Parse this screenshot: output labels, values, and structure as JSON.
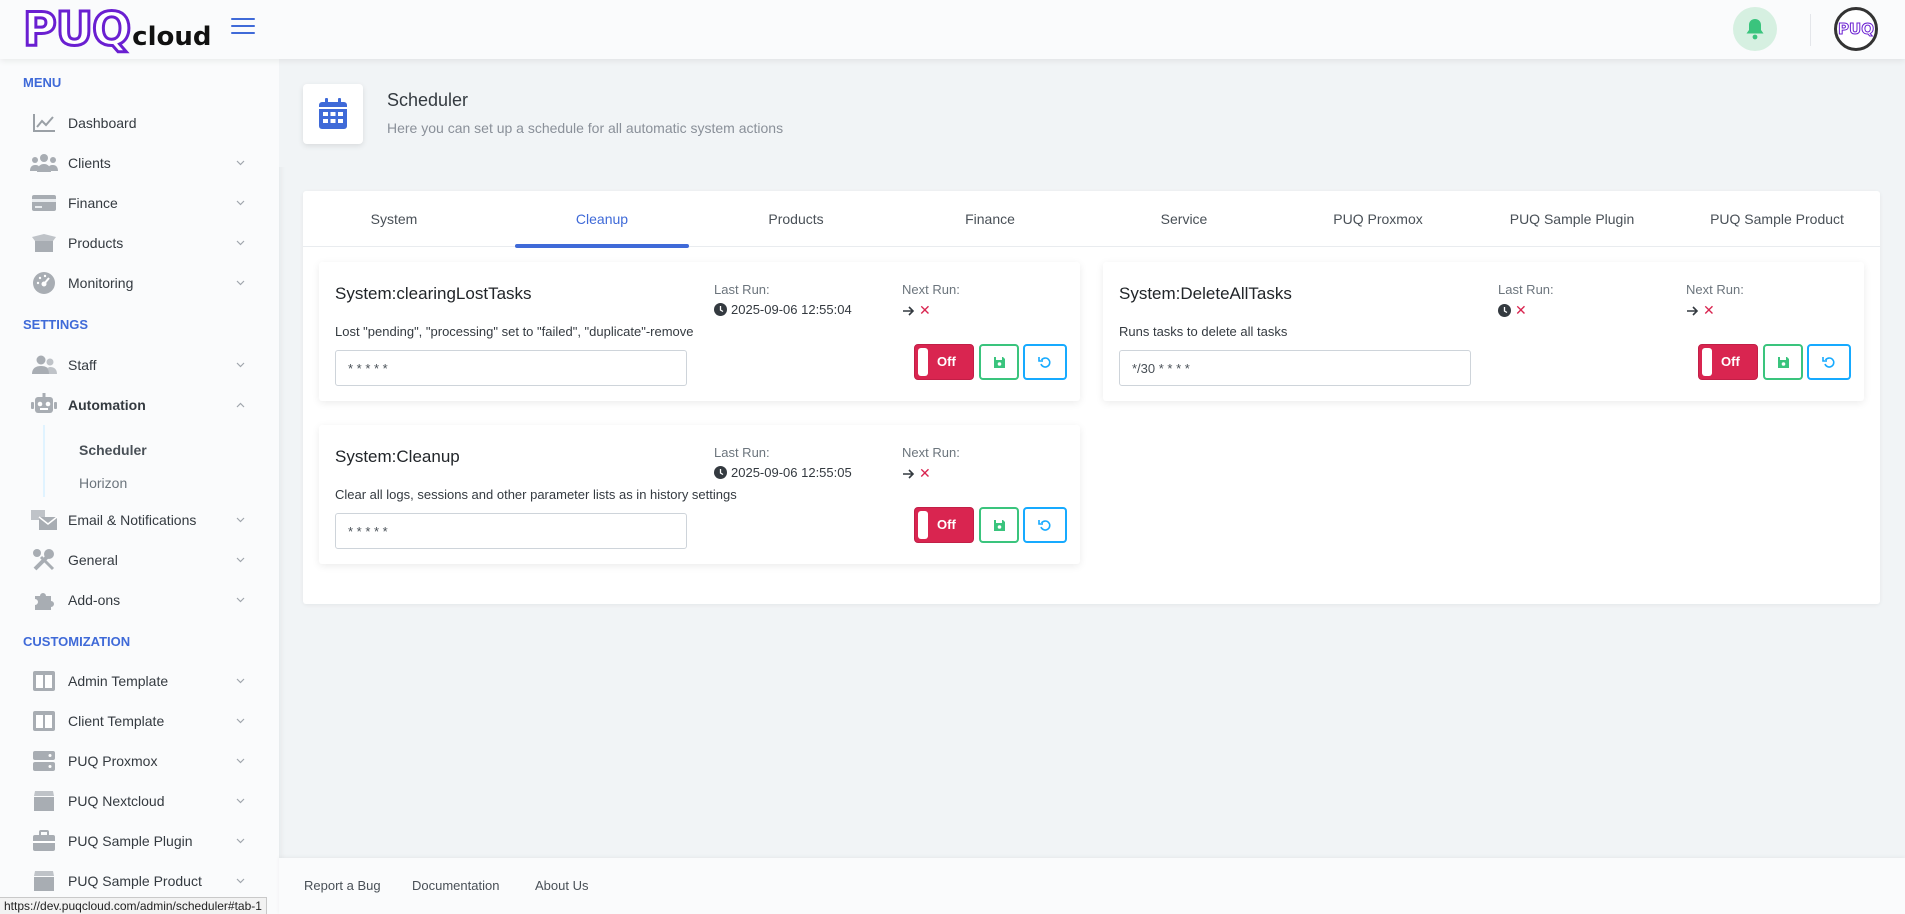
{
  "header": {
    "logo_puq": "PUQ",
    "logo_cloud": "cloud",
    "avatar_text": "PUQ"
  },
  "sidebar": {
    "menu_heading": "MENU",
    "settings_heading": "SETTINGS",
    "customization_heading": "CUSTOMIZATION",
    "menu_items": [
      {
        "label": "Dashboard",
        "icon": "chart-line-icon",
        "chevron": false
      },
      {
        "label": "Clients",
        "icon": "users-icon",
        "chevron": true
      },
      {
        "label": "Finance",
        "icon": "credit-card-icon",
        "chevron": true
      },
      {
        "label": "Products",
        "icon": "box-open-icon",
        "chevron": true
      },
      {
        "label": "Monitoring",
        "icon": "gauge-icon",
        "chevron": true
      }
    ],
    "settings_items": [
      {
        "label": "Staff",
        "icon": "user-group-icon",
        "chevron": true
      },
      {
        "label": "Automation",
        "icon": "robot-icon",
        "chevron": true,
        "expanded": true
      },
      {
        "label": "Email & Notifications",
        "icon": "mail-bulk-icon",
        "chevron": true
      },
      {
        "label": "General",
        "icon": "tools-icon",
        "chevron": true
      },
      {
        "label": "Add-ons",
        "icon": "puzzle-icon",
        "chevron": true
      }
    ],
    "automation_sub": [
      {
        "label": "Scheduler",
        "active": true
      },
      {
        "label": "Horizon",
        "active": false
      }
    ],
    "customization_items": [
      {
        "label": "Admin Template",
        "icon": "columns-icon",
        "chevron": true
      },
      {
        "label": "Client Template",
        "icon": "columns-icon",
        "chevron": true
      },
      {
        "label": "PUQ Proxmox",
        "icon": "server-icon",
        "chevron": true
      },
      {
        "label": "PUQ Nextcloud",
        "icon": "box-icon",
        "chevron": true
      },
      {
        "label": "PUQ Sample Plugin",
        "icon": "briefcase-icon",
        "chevron": true
      },
      {
        "label": "PUQ Sample Product",
        "icon": "box-icon",
        "chevron": true
      }
    ]
  },
  "page": {
    "title": "Scheduler",
    "subtitle": "Here you can set up a schedule for all automatic system actions"
  },
  "tabs": [
    {
      "label": "System",
      "active": false
    },
    {
      "label": "Cleanup",
      "active": true
    },
    {
      "label": "Products",
      "active": false
    },
    {
      "label": "Finance",
      "active": false
    },
    {
      "label": "Service",
      "active": false
    },
    {
      "label": "PUQ Proxmox",
      "active": false
    },
    {
      "label": "PUQ Sample Plugin",
      "active": false
    },
    {
      "label": "PUQ Sample Product",
      "active": false
    }
  ],
  "labels": {
    "last_run": "Last Run:",
    "next_run": "Next Run:",
    "toggle_off": "Off"
  },
  "tasks": [
    {
      "name": "System:clearingLostTasks",
      "description": "Lost \"pending\", \"processing\" set to \"failed\", \"duplicate\"-remove",
      "last_run": "2025-09-06 12:55:04",
      "cron": "* * * * *"
    },
    {
      "name": "System:DeleteAllTasks",
      "description": "Runs tasks to delete all tasks",
      "last_run": "",
      "cron": "*/30 * * * *"
    },
    {
      "name": "System:Cleanup",
      "description": "Clear all logs, sessions and other parameter lists as in history settings",
      "last_run": "2025-09-06 12:55:05",
      "cron": "* * * * *"
    }
  ],
  "footer": {
    "links": [
      "Report a Bug",
      "Documentation",
      "About Us"
    ]
  },
  "status_url": "https://dev.puqcloud.com/admin/scheduler#tab-1",
  "colors": {
    "primary": "#3f6ad8",
    "danger": "#d92550",
    "success": "#3ac47d",
    "info": "#16aaff",
    "brand": "#6a1fd1"
  }
}
